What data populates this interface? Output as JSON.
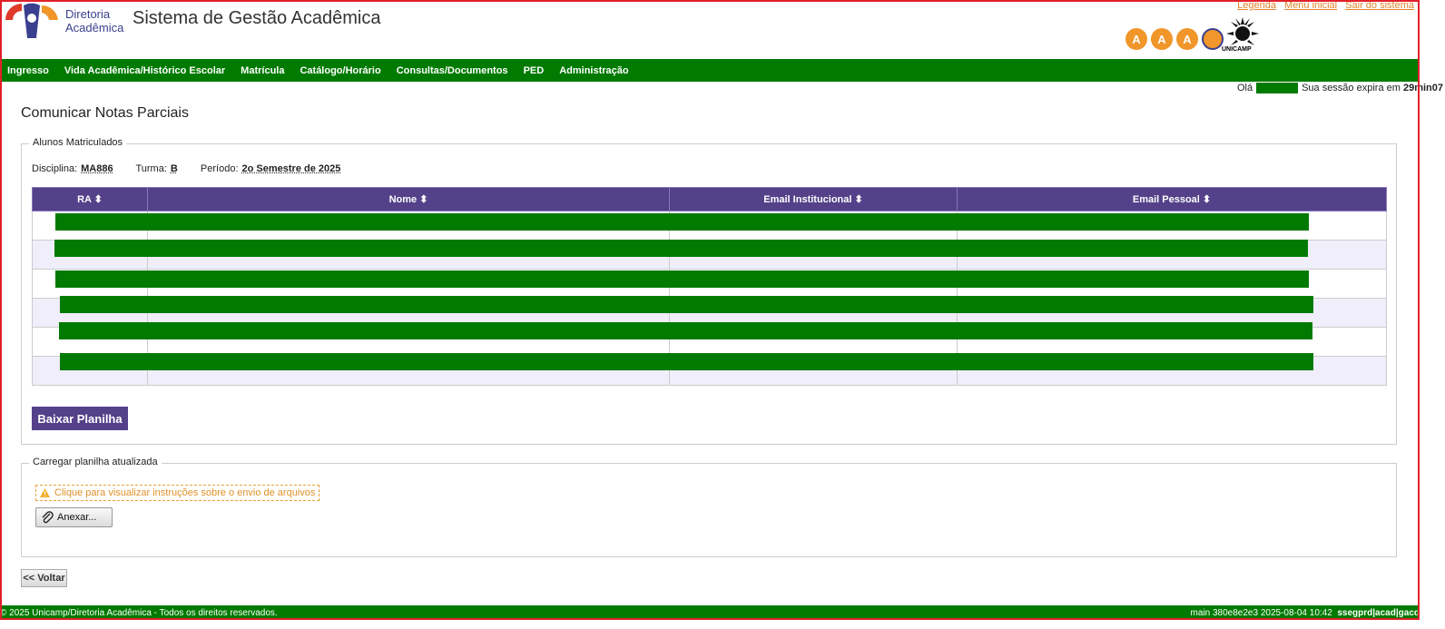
{
  "header": {
    "org_line1": "Diretoria",
    "org_line2": "Acadêmica",
    "system_title": "Sistema de Gestão Acadêmica",
    "links": [
      "Legenda",
      "Menu inicial",
      "Sair do sistema"
    ],
    "accessibility": [
      "A",
      "A",
      "A"
    ],
    "unicamp_label": "UNICAMP"
  },
  "nav": {
    "items": [
      "Ingresso",
      "Vida Acadêmica/Histórico Escolar",
      "Matrícula",
      "Catálogo/Horário",
      "Consultas/Documentos",
      "PED",
      "Administração"
    ]
  },
  "session": {
    "greeting": "Olá",
    "expires_text": "Sua sessão expira em",
    "expires_time": "29min07"
  },
  "page": {
    "title": "Comunicar Notas Parciais"
  },
  "students_box": {
    "legend": "Alunos Matriculados",
    "disciplina_label": "Disciplina:",
    "disciplina_value": "MA886",
    "turma_label": "Turma:",
    "turma_value": "B",
    "periodo_label": "Período:",
    "periodo_value": "2o Semestre de 2025",
    "columns": [
      "RA",
      "Nome",
      "Email Institucional",
      "Email Pessoal"
    ],
    "row_count": 6,
    "download_button": "Baixar Planilha"
  },
  "upload_box": {
    "legend": "Carregar planilha atualizada",
    "instructions_link": "Clique para visualizar instruções sobre o envio de arquivos",
    "attach_button": "Anexar..."
  },
  "back_button": "<< Voltar",
  "footer": {
    "left": "© 2025 Unicamp/Diretoria Acadêmica - Todos os direitos reservados.",
    "right_prefix": "main 380e8e2e3 2025-08-04 10:42",
    "right_bold": "ssegprd|acad|gacd"
  },
  "colors": {
    "nav_green": "#007a00",
    "header_purple": "#544189",
    "link_orange": "#e0832a",
    "frame_red": "#e0202a"
  }
}
